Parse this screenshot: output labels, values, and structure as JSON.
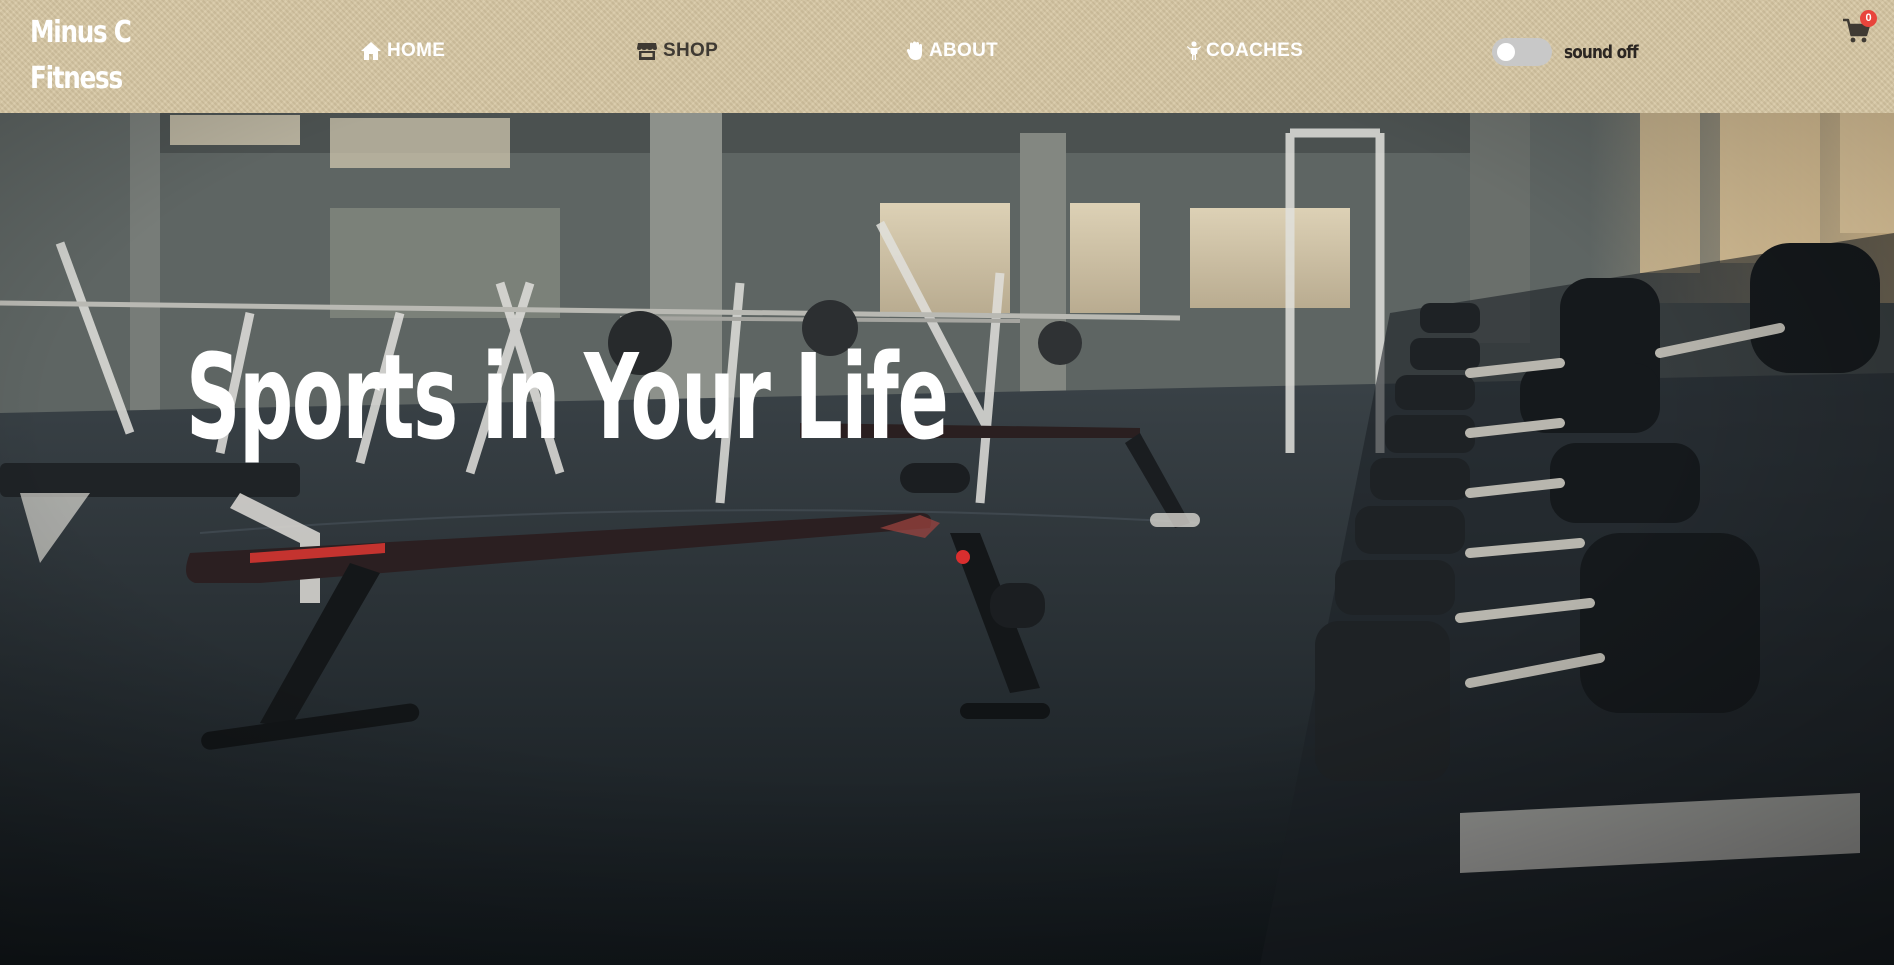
{
  "brand": {
    "line1": "Minus C",
    "line2": "Fitness"
  },
  "nav": {
    "items": [
      {
        "label": "HOME",
        "icon": "home-icon"
      },
      {
        "label": "SHOP",
        "icon": "store-icon"
      },
      {
        "label": "ABOUT",
        "icon": "hand-icon"
      },
      {
        "label": "COACHES",
        "icon": "person-icon"
      }
    ]
  },
  "sound": {
    "label": "sound off",
    "enabled": false
  },
  "cart": {
    "count": "0",
    "icon": "shopping-cart-icon"
  },
  "hero": {
    "title": "Sports in Your Life",
    "image": "gym-interior-photo"
  },
  "colors": {
    "header_bg": "#d6c6a2",
    "active_nav": "#3f3a33",
    "badge": "#e8453c"
  }
}
